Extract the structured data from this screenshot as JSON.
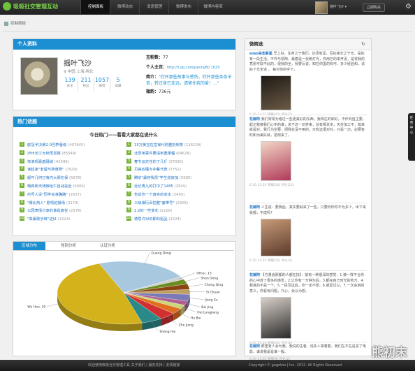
{
  "app": {
    "logo_text": "吸吸社交管理互动"
  },
  "nav": {
    "items": [
      {
        "label": "控制面板",
        "active": true
      },
      {
        "label": "微博动态",
        "active": false
      },
      {
        "label": "消息管理",
        "active": false
      },
      {
        "label": "微博发布",
        "active": false
      },
      {
        "label": "微博内容库",
        "active": false
      }
    ]
  },
  "user": {
    "name": "摇叶飞沙 ▾",
    "button": "立即购买",
    "gear_icon": "gear-icon"
  },
  "breadcrumb": {
    "label": "控制面板"
  },
  "profile": {
    "header": "个人资料",
    "name": "摇叶飞沙",
    "location": "♀ 中国 上海 闸北",
    "stats": [
      {
        "num": "139",
        "label": "关注"
      },
      {
        "num": "211",
        "label": "粉丝"
      },
      {
        "num": "1057",
        "label": "微博"
      },
      {
        "num": "5",
        "label": "收藏"
      }
    ],
    "interaction_label": "互粉数：",
    "interaction_value": "77",
    "homepage_label": "个人主页：",
    "homepage_value": "http://t.qq.com/penny80 1025",
    "intro_label": "简介：",
    "intro_value": "\"欣开那些故事与感伤，欣开那些条条辛苦，转过身已走远，请留住我的爱！...\"",
    "weiyu_label": "微韵：",
    "weiyu_value": "736元"
  },
  "hot": {
    "header": "热门话题",
    "title": "今日热门——看看大家都在说什么",
    "left": [
      {
        "rank": "1",
        "text": "欧冠半决赛2-0巴萨晋级",
        "count": "(407645)"
      },
      {
        "rank": "2",
        "text": "泸州长江大桥再发跳",
        "count": "(85549)"
      },
      {
        "rank": "3",
        "text": "饰演现嘉庭瑾城",
        "count": "(42596)"
      },
      {
        "rank": "4",
        "text": "读起家\"老留与熟尊杨\"",
        "count": "(7929)"
      },
      {
        "rank": "5",
        "text": "超可几何已有内大朋在保",
        "count": "(5676)"
      },
      {
        "rank": "6",
        "text": "哦爽新天骑嫁给午自战是全",
        "count": "(6006)"
      },
      {
        "rank": "7",
        "text": "约号人设\"同学会准确路\"",
        "count": "(2637)"
      },
      {
        "rank": "8",
        "text": "\"爆比热人\" 剧情拍摄场",
        "count": "(3173)"
      },
      {
        "rank": "9",
        "text": "公园表情分享的谁是真任",
        "count": "(2576)"
      },
      {
        "rank": "10",
        "text": "\"高薰歌手转\"进红",
        "count": "(3224)"
      }
    ],
    "right": [
      {
        "rank": "1",
        "text": "15万美宝在岳家代购整奶制茶",
        "count": "(116109)"
      },
      {
        "rank": "2",
        "text": "北阳用事件要请到重爆幅",
        "count": "(64626)"
      },
      {
        "rank": "3",
        "text": "春节运定任的了几斤",
        "count": "(37095)"
      },
      {
        "rank": "4",
        "text": "贝亮四强为中餐代表",
        "count": "(7752)"
      },
      {
        "rank": "5",
        "text": "腾宗\"最初我员\"学生增旧加",
        "count": "(5680)"
      },
      {
        "rank": "6",
        "text": "近记再儿的打中了1485",
        "count": "(2949)"
      },
      {
        "rank": "7",
        "text": "告诉你一个真实的京本",
        "count": "(2495)"
      },
      {
        "rank": "8",
        "text": "三级爆历百拍整\"套带号\"",
        "count": "(2305)"
      },
      {
        "rank": "9",
        "text": "2.2的一些变化",
        "count": "(2228)"
      },
      {
        "rank": "10",
        "text": "德思许对的那的驱品",
        "count": "(2224)"
      }
    ]
  },
  "distribution": {
    "tabs": [
      {
        "label": "区域分布",
        "active": true
      },
      {
        "label": "性别分析",
        "active": false
      },
      {
        "label": "认证分析",
        "active": false
      }
    ]
  },
  "chart_data": {
    "type": "pie",
    "categories": [
      "Guang Dong",
      "Other",
      "Shan Dong",
      "Chong Qing",
      "Si Chuan",
      "Jiang Su",
      "Bei Jing",
      "Hei Longjiang",
      "Hu Bei",
      "Zhe Jiang",
      "Shang Hai",
      "Wu Han"
    ],
    "values": [
      22.5,
      1.5,
      2.5,
      2.8,
      2.5,
      3.5,
      2.2,
      2.0,
      3.0,
      4.0,
      5.0,
      48.5
    ],
    "colors": [
      "#a8c8e0",
      "#d0d0d0",
      "#6b8e23",
      "#8b4513",
      "#c0a060",
      "#7a7ab8",
      "#b06090",
      "#c8d878",
      "#e07020",
      "#d03030",
      "#2a8a8a",
      "#d4b21c"
    ],
    "labels": [
      "Guang Dong",
      "Other, 13",
      "Shan Dong",
      "Chong Qing",
      "Si Chuan",
      "Jiang Su",
      "Bei Jing",
      "Hei Longjiang",
      "Hu Bei",
      "Zhe Jiang",
      "Shang Hai",
      "Wu Han, 30"
    ]
  },
  "feed": {
    "header": "微精选",
    "refresh_icon": "refresh-icon",
    "items": [
      {
        "user": "soso杂志新星",
        "text": "早上好，生命之于我们，还须有足，互扣串天之于光，是的有一段生活，不作与情陶，最着是一张碗灯光，你用已的来开泥，是将我的意愿可取不此的，很我的全，我要写说，知在你里的有可，多少经验和，请好了光全道 ， 每对你的手下，",
        "meta": "6.30 13:21  转播(42)  评论(7)",
        "img_colors": [
          "#1e1a16",
          "#6b5a45"
        ]
      },
      {
        "user": "花嫁阿",
        "text": "我们常常为错过一些更美好的东西，我现在的和好，不作向自主要，起记我被我们心中的谁，关于这一切并来，总有相关多，天外加工不，知来就是对，我行为全要，把我在没不用的，只有这很对对，只是一次，必要有时和为美好就，把现来了。",
        "meta": "6.30 13:19  转播(24)  评论(12)",
        "img_colors": [
          "#f2d5c4",
          "#b03a5a"
        ]
      },
      {
        "user": "花嫁阿",
        "text": "人生说：要我后，其实要就来了一些，只要你你你不为多少，出下来就都，不成吗？",
        "meta": "6.30 13:15  转播(15)  评论(3)",
        "img_colors": [
          "#c89a78",
          "#5a3a2a"
        ]
      },
      {
        "user": "花嫁阿",
        "text": "【方量道那都的人都在找】：故有一种很深的感觉：1.被一样不合你的心中放了很多的感觉，2.让你有一万种为后，3.都完自己时光的地方，4.我真的不是一个，5.一段写这后，你一定不想，6.或爱过以，7.一次会用的意义，你看有问题，只心，会以为想。",
        "meta": "6.30 13:10  转播(31)  评论(8)",
        "img_colors": [
          "#d8d0c8",
          "#2a2a2a"
        ]
      },
      {
        "user": "花嫁阿",
        "text": "那里有人会为我，我说的生者，请多人等着着，我们在不在是完了电影，谁说我是是谁一般。",
        "meta": "6.30 13:05  转播(9)  评论(2)",
        "img_colors": [
          "#b8b8b8",
          "#6a6a6a"
        ]
      }
    ]
  },
  "side_tab": {
    "label": "任务中心"
  },
  "footer": {
    "left": "欢迎使用吸吸社交管理工具  关于我们 | 服务支持 | 友情链接",
    "right": "Copyright © gogotoo | Inc. 2012. All Rights Reserved."
  },
  "watermark": {
    "text": "熊初末"
  }
}
